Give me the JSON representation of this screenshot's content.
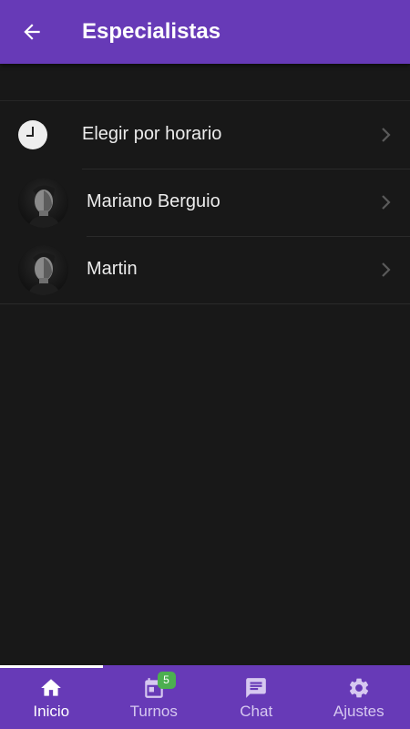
{
  "header": {
    "title": "Especialistas",
    "back_icon": "arrow-left-icon",
    "background": "#673ab7"
  },
  "list": {
    "items": [
      {
        "label": "Elegir por horario",
        "icon": "clock-icon"
      },
      {
        "label": "Mariano Berguio",
        "icon": "avatar"
      },
      {
        "label": "Martin",
        "icon": "avatar"
      }
    ],
    "chevron_icon": "chevron-right-icon"
  },
  "bottom_nav": {
    "items": [
      {
        "label": "Inicio",
        "icon": "home-icon",
        "active": true
      },
      {
        "label": "Turnos",
        "icon": "calendar-icon",
        "badge": "5"
      },
      {
        "label": "Chat",
        "icon": "chat-icon"
      },
      {
        "label": "Ajustes",
        "icon": "gear-icon"
      }
    ],
    "badge_color": "#4caf50"
  },
  "colors": {
    "background": "#181818",
    "accent": "#673ab7",
    "text": "#ececec"
  }
}
